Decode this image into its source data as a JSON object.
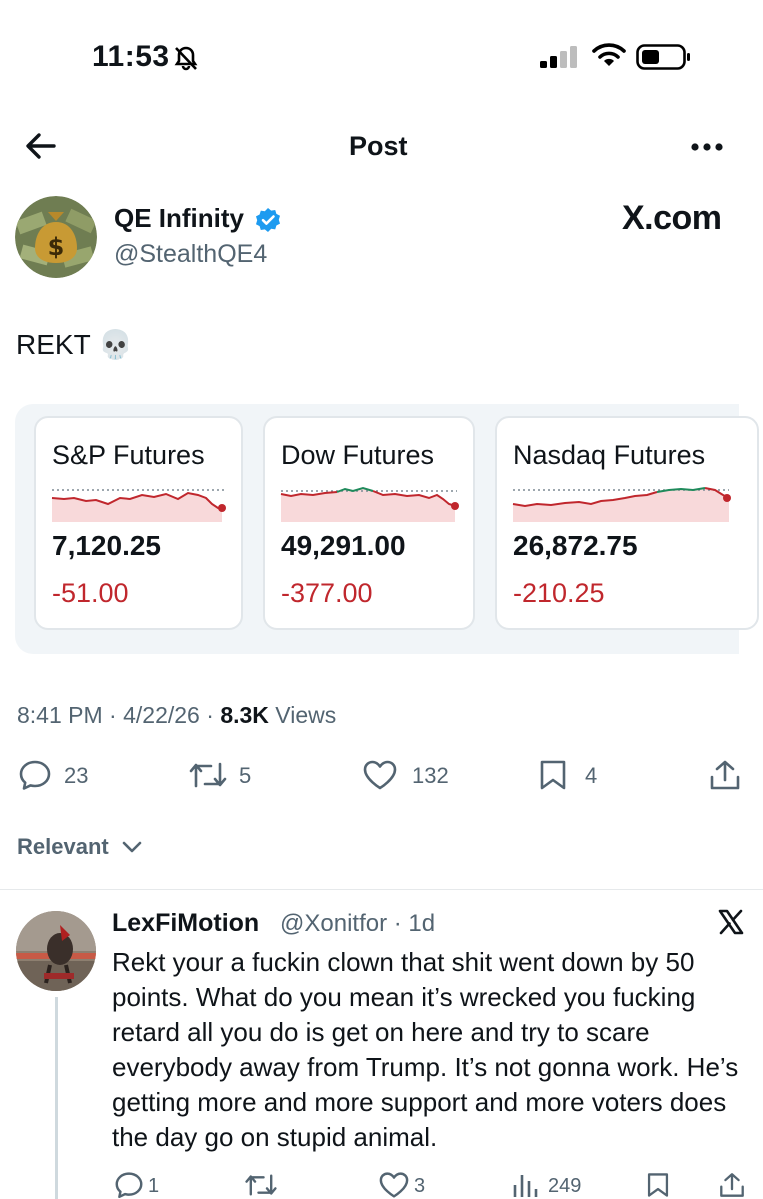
{
  "status_bar": {
    "time": "11:53",
    "icons": [
      "bell-slash-icon",
      "signal-icon",
      "wifi-icon",
      "battery-icon"
    ]
  },
  "header": {
    "title": "Post",
    "icons": [
      "back-arrow-icon",
      "more-icon"
    ]
  },
  "author": {
    "name": "QE Infinity",
    "handle": "@StealthQE4",
    "brand": "X.com"
  },
  "post": {
    "text": "REKT 💀",
    "time": "8:41 PM",
    "date": "4/22/26",
    "views_count": "8.3K",
    "views_label": "Views"
  },
  "futures": [
    {
      "name": "S&P Futures",
      "price": "7,120.25",
      "change": "-51.00"
    },
    {
      "name": "Dow Futures",
      "price": "49,291.00",
      "change": "-377.00"
    },
    {
      "name": "Nasdaq Futures",
      "price": "26,872.75",
      "change": "-210.25"
    }
  ],
  "actions": {
    "replies": "23",
    "reposts": "5",
    "likes": "132",
    "bookmarks": "4"
  },
  "sort": {
    "label": "Relevant"
  },
  "reply": {
    "name": "LexFiMotion",
    "handle": "@Xonitfor",
    "time": "1d",
    "text": "Rekt your a fuckin clown that shit went down by 50 points. What do you mean it’s wrecked you fucking retard all you do is get on here and try to scare everybody away from Trump. It’s not gonna work. He’s getting more and more support and more voters does the day go on stupid animal.",
    "actions": {
      "replies": "1",
      "likes": "3",
      "views": "249"
    }
  },
  "colors": {
    "negative": "#c0272d",
    "positive": "#1f8a5b",
    "verified": "#1d9bf0",
    "muted": "#536471"
  }
}
